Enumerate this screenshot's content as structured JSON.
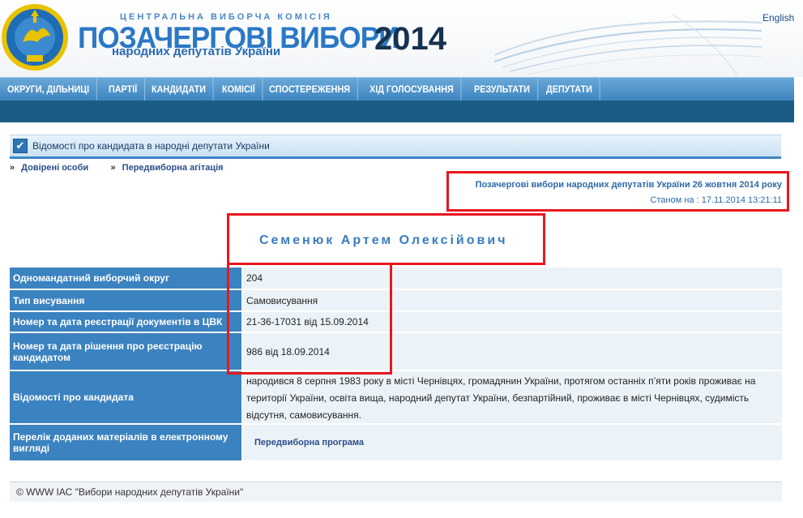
{
  "header": {
    "org_name": "ЦЕНТРАЛЬНА ВИБОРЧА КОМІСІЯ",
    "title": "ПОЗАЧЕРГОВІ ВИБОРИ",
    "subtitle": "народних депутатів України",
    "year": "2014",
    "language_link": "English",
    "emblem_text": "ЦЕНТРАЛЬНА ВИБОРЧА КОМІСІЯ"
  },
  "nav": {
    "items": [
      {
        "label": "ОКРУГИ, ДІЛЬНИЦІ"
      },
      {
        "label": "ПАРТІЇ"
      },
      {
        "label": "КАНДИДАТИ"
      },
      {
        "label": "КОМІСІЇ"
      },
      {
        "label": "СПОСТЕРЕЖЕННЯ"
      },
      {
        "label": "ХІД ГОЛОСУВАННЯ"
      },
      {
        "label": "РЕЗУЛЬТАТИ"
      },
      {
        "label": "ДЕПУТАТИ"
      }
    ]
  },
  "section": {
    "title": "Відомості про кандидата в народні депутати України"
  },
  "sub_links": [
    {
      "label": "Довірені особи"
    },
    {
      "label": "Передвиборна агітація"
    }
  ],
  "election": {
    "name": "Позачергові вибори народних депутатів України 26 жовтня 2014 року",
    "status_label": "Станом на : ",
    "status_value": "17.11.2014 13:21:11"
  },
  "candidate": {
    "name": "Семенюк Артем Олексійович",
    "rows": [
      {
        "label": "Одномандатний виборчий округ",
        "value": "204"
      },
      {
        "label": "Тип висування",
        "value": "Самовисування"
      },
      {
        "label": "Номер та дата реєстрації документів в ЦВК",
        "value": "21-36-17031 від 15.09.2014"
      },
      {
        "label": "Номер та дата рішення про реєстрацію кандидатом",
        "value": "986 від 18.09.2014"
      },
      {
        "label": "Відомості про кандидата",
        "value": "народився 8 серпня 1983 року в місті Чернівцях, громадянин України, протягом останніх п’яти років проживає на території України, освіта вища, народний депутат України, безпартійний, проживає в місті Чернівцях, судимість відсутня, самовисування."
      },
      {
        "label": "Перелік доданих матеріалів в електронному вигляді",
        "value": "Передвиборна програма"
      }
    ]
  },
  "footer": {
    "text": "© WWW ІАС \"Вибори народних депутатів України\""
  },
  "colors": {
    "nav_bg": "#3d84c0",
    "label_bg": "#3b82c0",
    "value_bg": "#ecf3f8",
    "highlight": "#e8171f",
    "title_blue": "#2a78c6"
  }
}
